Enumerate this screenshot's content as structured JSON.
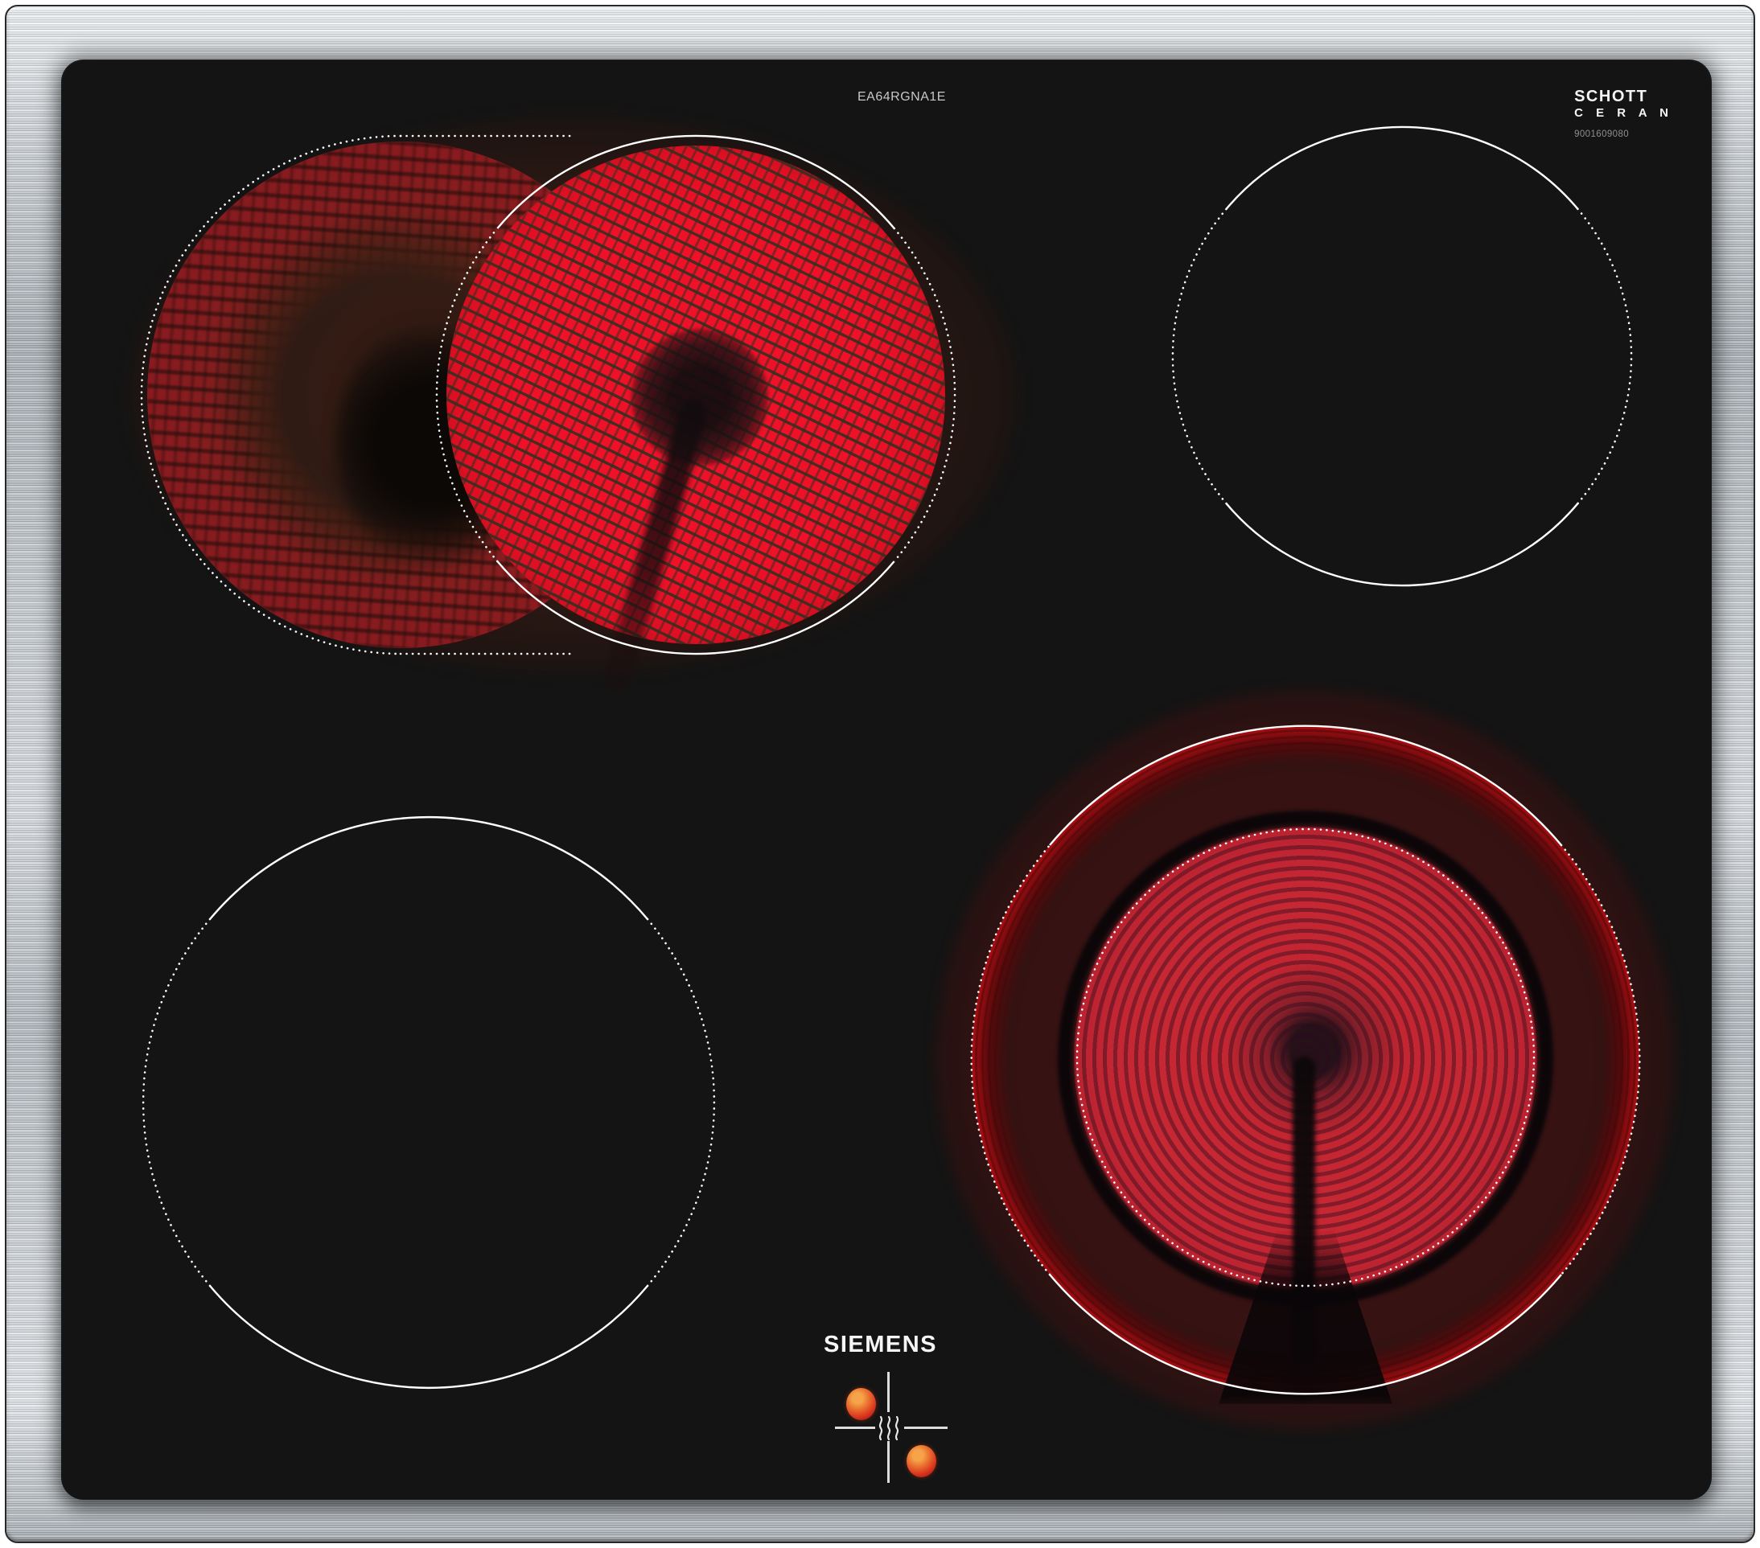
{
  "product": {
    "brand": "SIEMENS",
    "model_number": "EA64RGNA1E",
    "glass_brand_line1": "SCHOTT",
    "glass_brand_line2": "C E R A N",
    "print_code": "9001609080"
  },
  "zones": [
    {
      "id": "rear-left",
      "type": "dual-circuit oval zone",
      "status": "on",
      "glow": "bright red heating element with extension crescent lit"
    },
    {
      "id": "rear-right",
      "type": "standard zone",
      "status": "off",
      "glow": "none"
    },
    {
      "id": "front-left",
      "type": "standard large zone",
      "status": "off",
      "glow": "none"
    },
    {
      "id": "front-right",
      "type": "dual-ring large zone",
      "status": "on",
      "glow": "bright red outer ring and inner coil lit"
    }
  ],
  "indicators": {
    "heat_waves_icon": "sss",
    "residual_heat_dots": [
      {
        "zone": "rear-left",
        "state": "on"
      },
      {
        "zone": "front-right",
        "state": "on"
      }
    ]
  },
  "colors": {
    "frame_steel_light": "#e4e7ea",
    "frame_steel_mid": "#b2b8bd",
    "glass_black": "#141414",
    "glow_red": "#e41019",
    "glow_dim_red": "#c22734",
    "pattern_gap_brown": "#564535",
    "ember_orange": "#ec7a33",
    "outline_white": "#ffffff",
    "model_text_gray": "#c7c7c7",
    "print_code_gray": "#8f8f8f"
  }
}
